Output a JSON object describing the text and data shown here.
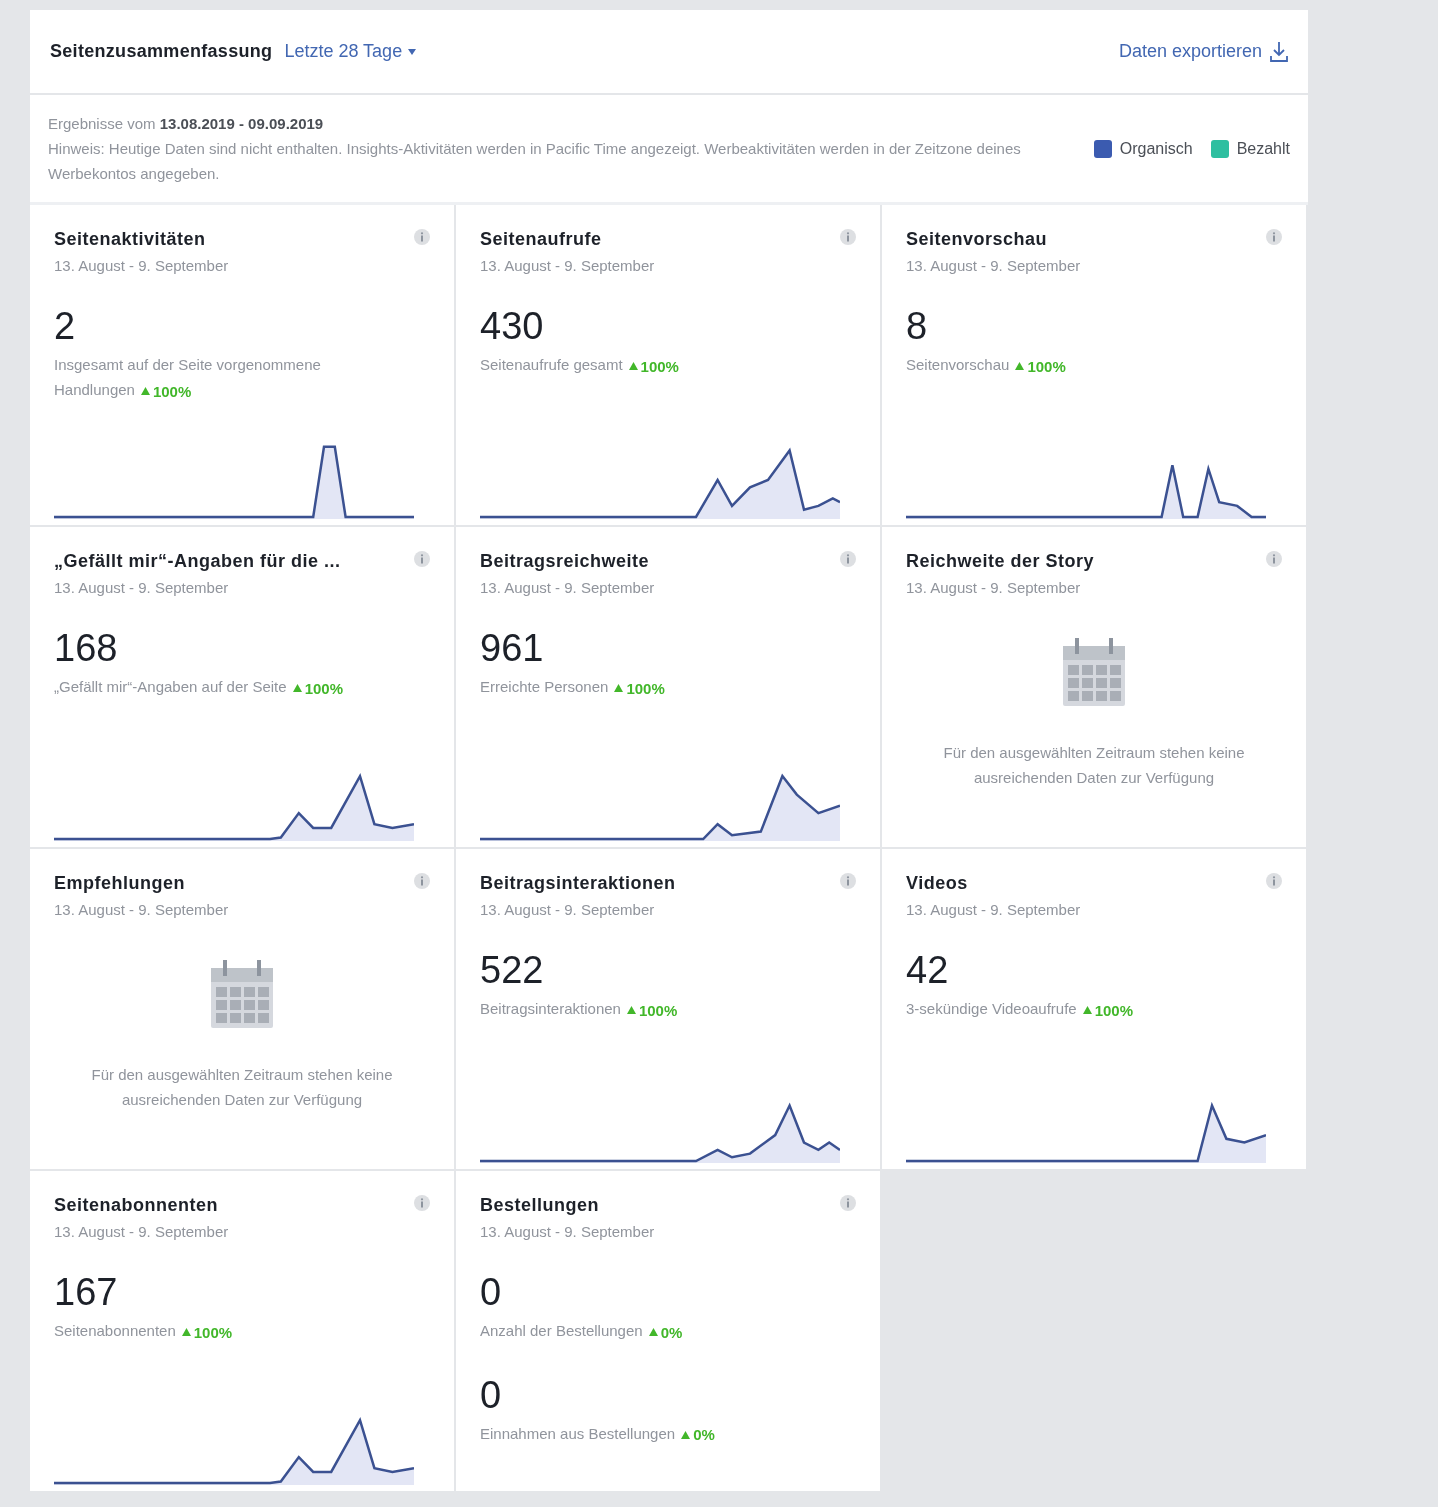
{
  "header": {
    "title": "Seitenzusammenfassung",
    "period": "Letzte 28 Tage",
    "export": "Daten exportieren"
  },
  "notice": {
    "range": "Ergebnisse vom **13.08.2019 - 09.09.2019**",
    "hint": "Hinweis: Heutige Daten sind nicht enthalten. Insights-Aktivitäten werden in Pacific Time angezeigt. Werbeaktivitäten werden in der Zeitzone deines Werbekontos angegeben."
  },
  "legend": [
    {
      "label": "Organisch",
      "color": "#3b5bb0"
    },
    {
      "label": "Bezahlt",
      "color": "#2ebfa0"
    }
  ],
  "cards": [
    {
      "kind": "metric",
      "title": "Seitenaktivitäten",
      "dates": "13. August - 9. September",
      "sparkline": true,
      "metrics": [
        {
          "value": "2",
          "label": "Insgesamt auf der Seite vorgenommene Handlungen",
          "change": "100%"
        }
      ]
    },
    {
      "kind": "metric",
      "title": "Seitenaufrufe",
      "dates": "13. August - 9. September",
      "sparkline": true,
      "metrics": [
        {
          "value": "430",
          "label": "Seitenaufrufe gesamt",
          "change": "100%"
        }
      ]
    },
    {
      "kind": "metric",
      "title": "Seitenvorschau",
      "dates": "13. August - 9. September",
      "sparkline": true,
      "metrics": [
        {
          "value": "8",
          "label": "Seitenvorschau",
          "change": "100%"
        }
      ]
    },
    {
      "kind": "metric",
      "title": "„Gefällt mir“-Angaben für die ...",
      "dates": "13. August - 9. September",
      "sparkline": true,
      "metrics": [
        {
          "value": "168",
          "label": "„Gefällt mir“-Angaben auf der Seite",
          "change": "100%"
        }
      ]
    },
    {
      "kind": "metric",
      "title": "Beitragsreichweite",
      "dates": "13. August - 9. September",
      "sparkline": true,
      "metrics": [
        {
          "value": "961",
          "label": "Erreichte Personen",
          "change": "100%"
        }
      ]
    },
    {
      "kind": "empty",
      "title": "Reichweite der Story",
      "dates": "13. August - 9. September",
      "message": "Für den ausgewählten Zeitraum stehen keine ausreichenden Daten zur Verfügung"
    },
    {
      "kind": "empty",
      "title": "Empfehlungen",
      "dates": "13. August - 9. September",
      "message": "Für den ausgewählten Zeitraum stehen keine ausreichenden Daten zur Verfügung"
    },
    {
      "kind": "metric",
      "title": "Beitragsinteraktionen",
      "dates": "13. August - 9. September",
      "sparkline": true,
      "metrics": [
        {
          "value": "522",
          "label": "Beitragsinteraktionen",
          "change": "100%"
        }
      ]
    },
    {
      "kind": "metric",
      "title": "Videos",
      "dates": "13. August - 9. September",
      "sparkline": true,
      "metrics": [
        {
          "value": "42",
          "label": "3-sekündige Videoaufrufe",
          "change": "100%"
        }
      ]
    },
    {
      "kind": "metric",
      "title": "Seitenabonnenten",
      "dates": "13. August - 9. September",
      "sparkline": true,
      "metrics": [
        {
          "value": "167",
          "label": "Seitenabonnenten",
          "change": "100%"
        }
      ]
    },
    {
      "kind": "metric",
      "title": "Bestellungen",
      "dates": "13. August - 9. September",
      "sparkline": false,
      "metrics": [
        {
          "value": "0",
          "label": "Anzahl der Bestellungen",
          "change": "0%"
        },
        {
          "value": "0",
          "label": "Einnahmen aus Bestellungen",
          "change": "0%"
        }
      ]
    }
  ]
}
